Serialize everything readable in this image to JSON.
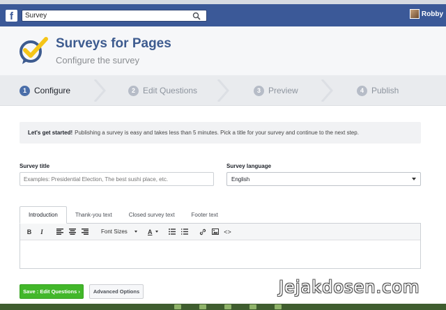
{
  "facebook": {
    "logo_letter": "f",
    "search_value": "Survey",
    "user_name": "Robby"
  },
  "header": {
    "title": "Surveys for Pages",
    "subtitle": "Configure the survey"
  },
  "steps": [
    {
      "num": "1",
      "label": "Configure"
    },
    {
      "num": "2",
      "label": "Edit Questions"
    },
    {
      "num": "3",
      "label": "Preview"
    },
    {
      "num": "4",
      "label": "Publish"
    }
  ],
  "notice": {
    "strong": "Let's get started!",
    "text": "Publishing a survey is easy and takes less than 5 minutes. Pick a title for your survey and continue to the next step."
  },
  "form": {
    "title_label": "Survey title",
    "title_placeholder": "Examples: Presidential Election, The best sushi place, etc.",
    "language_label": "Survey language",
    "language_value": "English"
  },
  "editor_tabs": [
    "Introduction",
    "Thank-you text",
    "Closed survey text",
    "Footer text"
  ],
  "toolbar": {
    "bold": "B",
    "italic": "I",
    "font_sizes": "Font Sizes",
    "font_color": "A",
    "code": "<>"
  },
  "buttons": {
    "save": "Save : Edit Questions ›",
    "advanced": "Advanced Options"
  },
  "watermark": "Jejakdosen.com",
  "colors": {
    "facebook_blue": "#3b5998",
    "accent": "#4a6ea9",
    "save_green": "#42b72a"
  }
}
